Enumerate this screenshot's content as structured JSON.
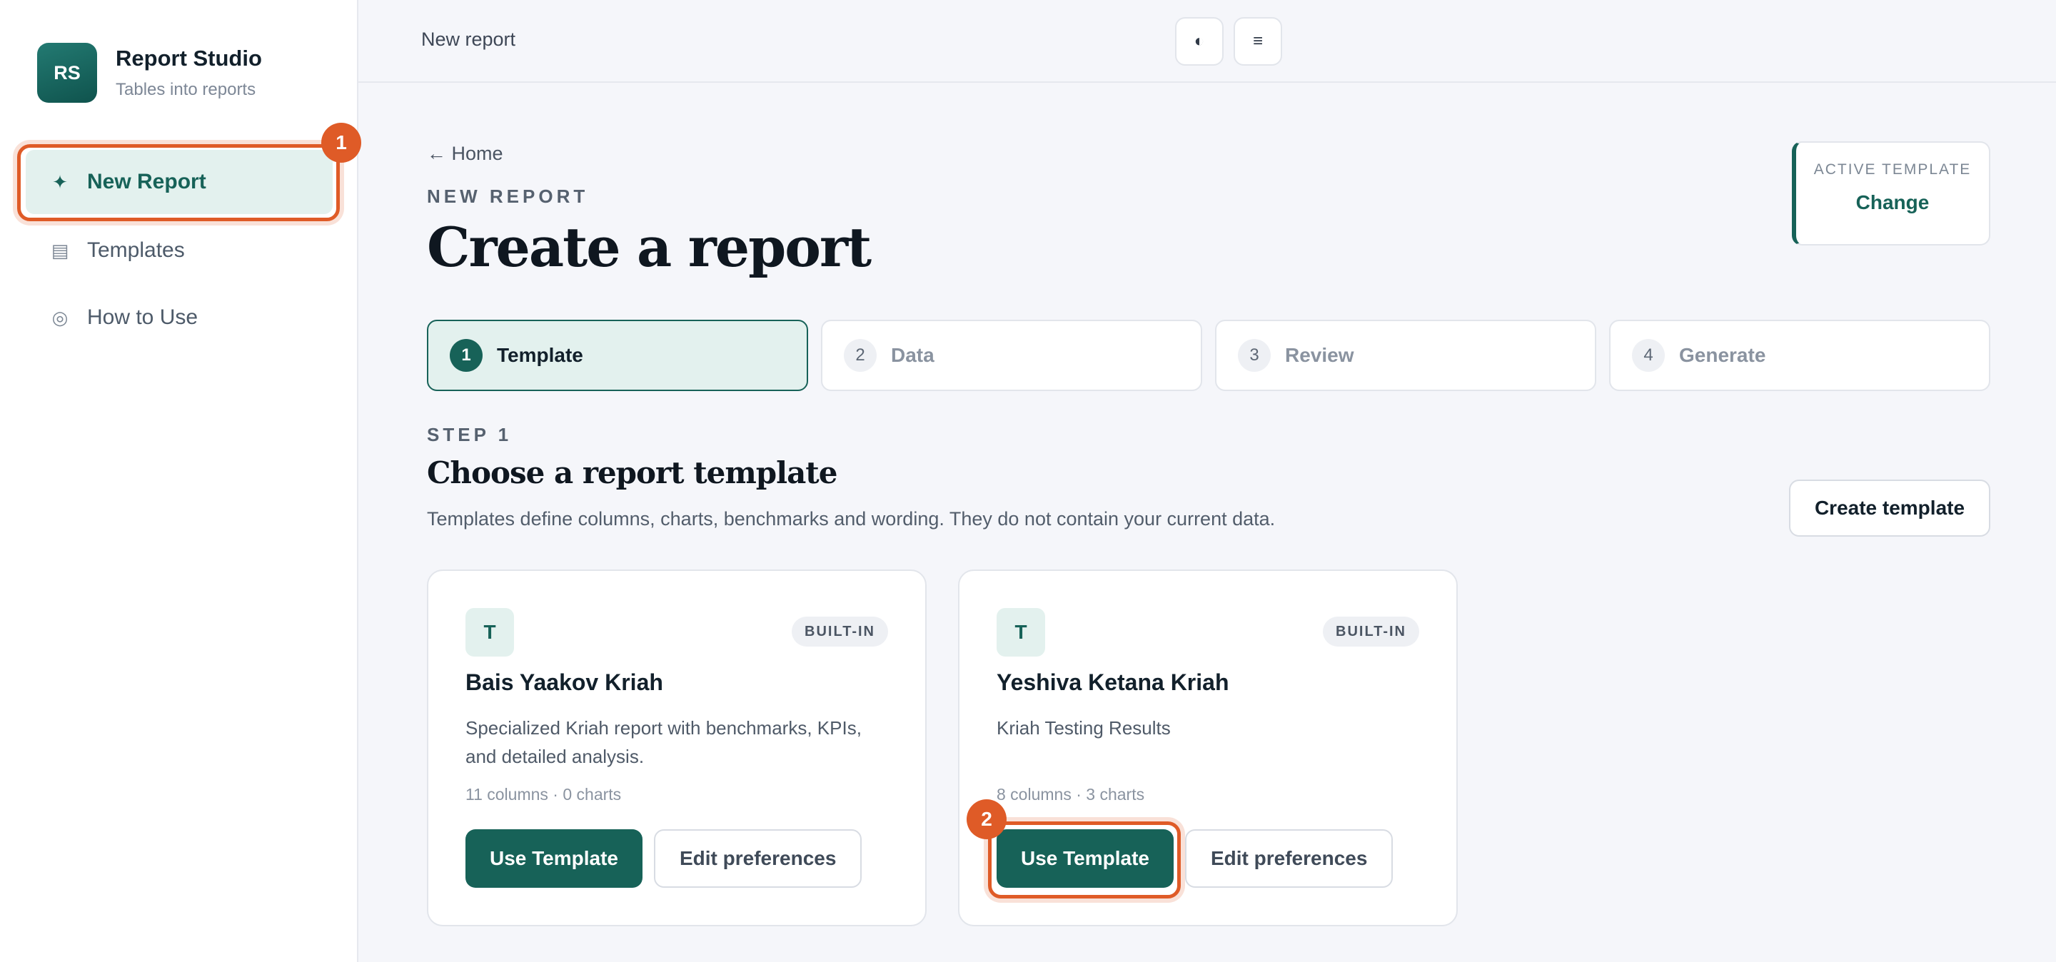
{
  "brand": {
    "logo": "RS",
    "name": "Report Studio",
    "tagline": "Tables into reports"
  },
  "sidebar": {
    "items": [
      {
        "label": "New Report",
        "icon": "sparkle-icon",
        "glyph": "✦",
        "active": true
      },
      {
        "label": "Templates",
        "icon": "table-icon",
        "glyph": "▤",
        "active": false
      },
      {
        "label": "How to Use",
        "icon": "help-circle-icon",
        "glyph": "◎",
        "active": false
      }
    ]
  },
  "topbar": {
    "title": "New report",
    "theme_toggle_glyph": "◐",
    "menu_glyph": "≡"
  },
  "page": {
    "back_link": "← Home",
    "eyebrow": "NEW REPORT",
    "title": "Create a report"
  },
  "active_template": {
    "label": "ACTIVE TEMPLATE",
    "action": "Change"
  },
  "steps": [
    {
      "num": "1",
      "label": "Template",
      "active": true
    },
    {
      "num": "2",
      "label": "Data",
      "active": false
    },
    {
      "num": "3",
      "label": "Review",
      "active": false
    },
    {
      "num": "4",
      "label": "Generate",
      "active": false
    }
  ],
  "section": {
    "eyebrow": "STEP 1",
    "title": "Choose a report template",
    "description": "Templates define columns, charts, benchmarks and wording. They do not contain your current data.",
    "create_button": "Create template"
  },
  "templates": [
    {
      "icon": "T",
      "badge": "BUILT-IN",
      "name": "Bais Yaakov Kriah",
      "description": "Specialized Kriah report with benchmarks, KPIs, and detailed analysis.",
      "meta": "11 columns · 0 charts",
      "primary_action": "Use Template",
      "secondary_action": "Edit preferences"
    },
    {
      "icon": "T",
      "badge": "BUILT-IN",
      "name": "Yeshiva Ketana Kriah",
      "description": "Kriah Testing Results",
      "meta": "8 columns · 3 charts",
      "primary_action": "Use Template",
      "secondary_action": "Edit preferences"
    }
  ],
  "annotations": [
    {
      "number": "1"
    },
    {
      "number": "2"
    }
  ],
  "colors": {
    "accent": "#176258",
    "accent_light": "#e3f1ee",
    "annotation": "#df5b27",
    "background": "#f5f6fa"
  }
}
